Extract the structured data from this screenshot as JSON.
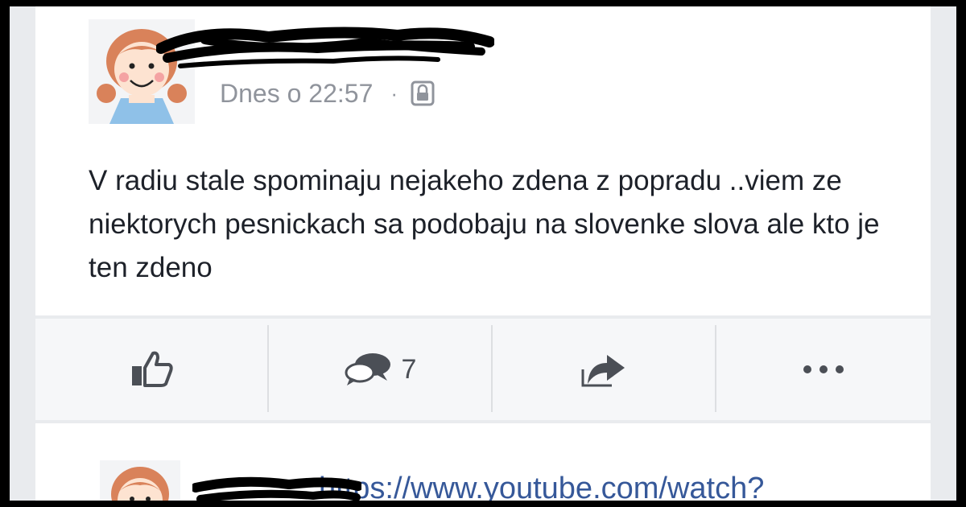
{
  "post": {
    "timestamp": "Dnes o 22:57",
    "separator": "·",
    "privacy_icon": "lock-icon",
    "text": "V radiu stale spominaju nejakeho zdena z popradu ..viem ze niektorych pesnickach sa podobaju na slovenke slova ale kto je ten zdeno"
  },
  "actions": {
    "like_icon": "thumbs-up-icon",
    "comment_icon": "comment-bubbles-icon",
    "comment_count": "7",
    "share_icon": "share-arrow-icon",
    "more_icon": "more-dots-icon"
  },
  "comment": {
    "link_text": "https://www.youtube.com/watch?"
  },
  "colors": {
    "background_frame": "#000000",
    "card": "#ffffff",
    "page": "#e9ebee",
    "action_bar": "#f6f7f9",
    "text": "#1d2129",
    "meta": "#90949c",
    "icon": "#4b4f56",
    "link": "#365899"
  }
}
